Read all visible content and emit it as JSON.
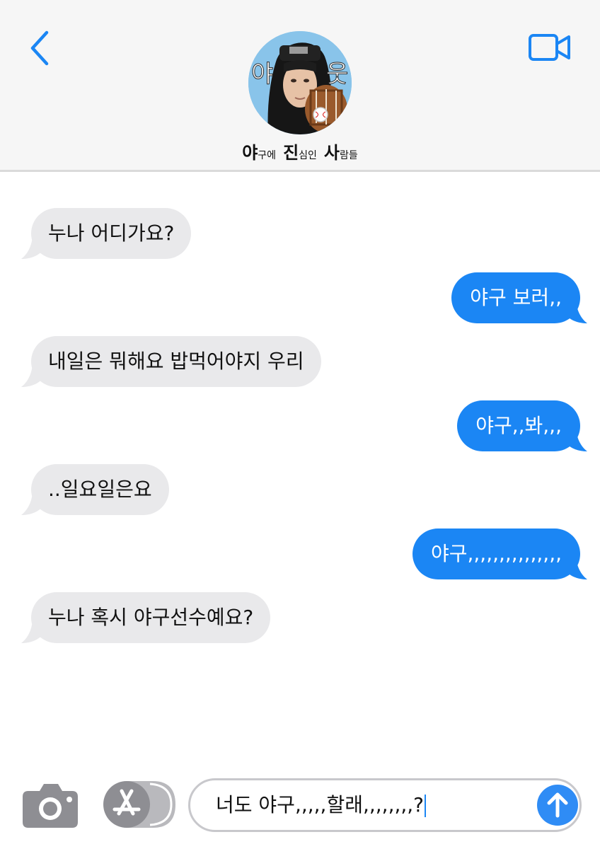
{
  "header": {
    "back_icon": "chevron-left-icon",
    "video_icon": "video-camera-icon",
    "avatar_text_left": "야",
    "avatar_text_right": "웃",
    "contact_name": {
      "p1_big": "야",
      "p1_small": "구에",
      "p2_big": "진",
      "p2_small": "심인",
      "p3_big": "사",
      "p3_small": "람들"
    }
  },
  "messages": [
    {
      "direction": "incoming",
      "text": "누나 어디가요?"
    },
    {
      "direction": "outgoing",
      "text": "야구 보러,,"
    },
    {
      "direction": "incoming",
      "text": "내일은 뭐해요 밥먹어야지 우리"
    },
    {
      "direction": "outgoing",
      "text": "야구,,봐,,,"
    },
    {
      "direction": "incoming",
      "text": "..일요일은요"
    },
    {
      "direction": "outgoing",
      "text": "야구,,,,,,,,,,,,,,,"
    },
    {
      "direction": "incoming",
      "text": "누나 혹시 야구선수예요?"
    }
  ],
  "input_bar": {
    "camera_icon": "camera-icon",
    "apps_icon": "app-store-icon",
    "draft_text": "너도 야구,,,,,할래,,,,,,,,?",
    "send_icon": "arrow-up-icon"
  },
  "colors": {
    "accent": "#1b86f4",
    "incoming_bubble": "#e9e9eb",
    "header_bg": "#f6f6f6",
    "icon_gray": "#8e8e93"
  }
}
